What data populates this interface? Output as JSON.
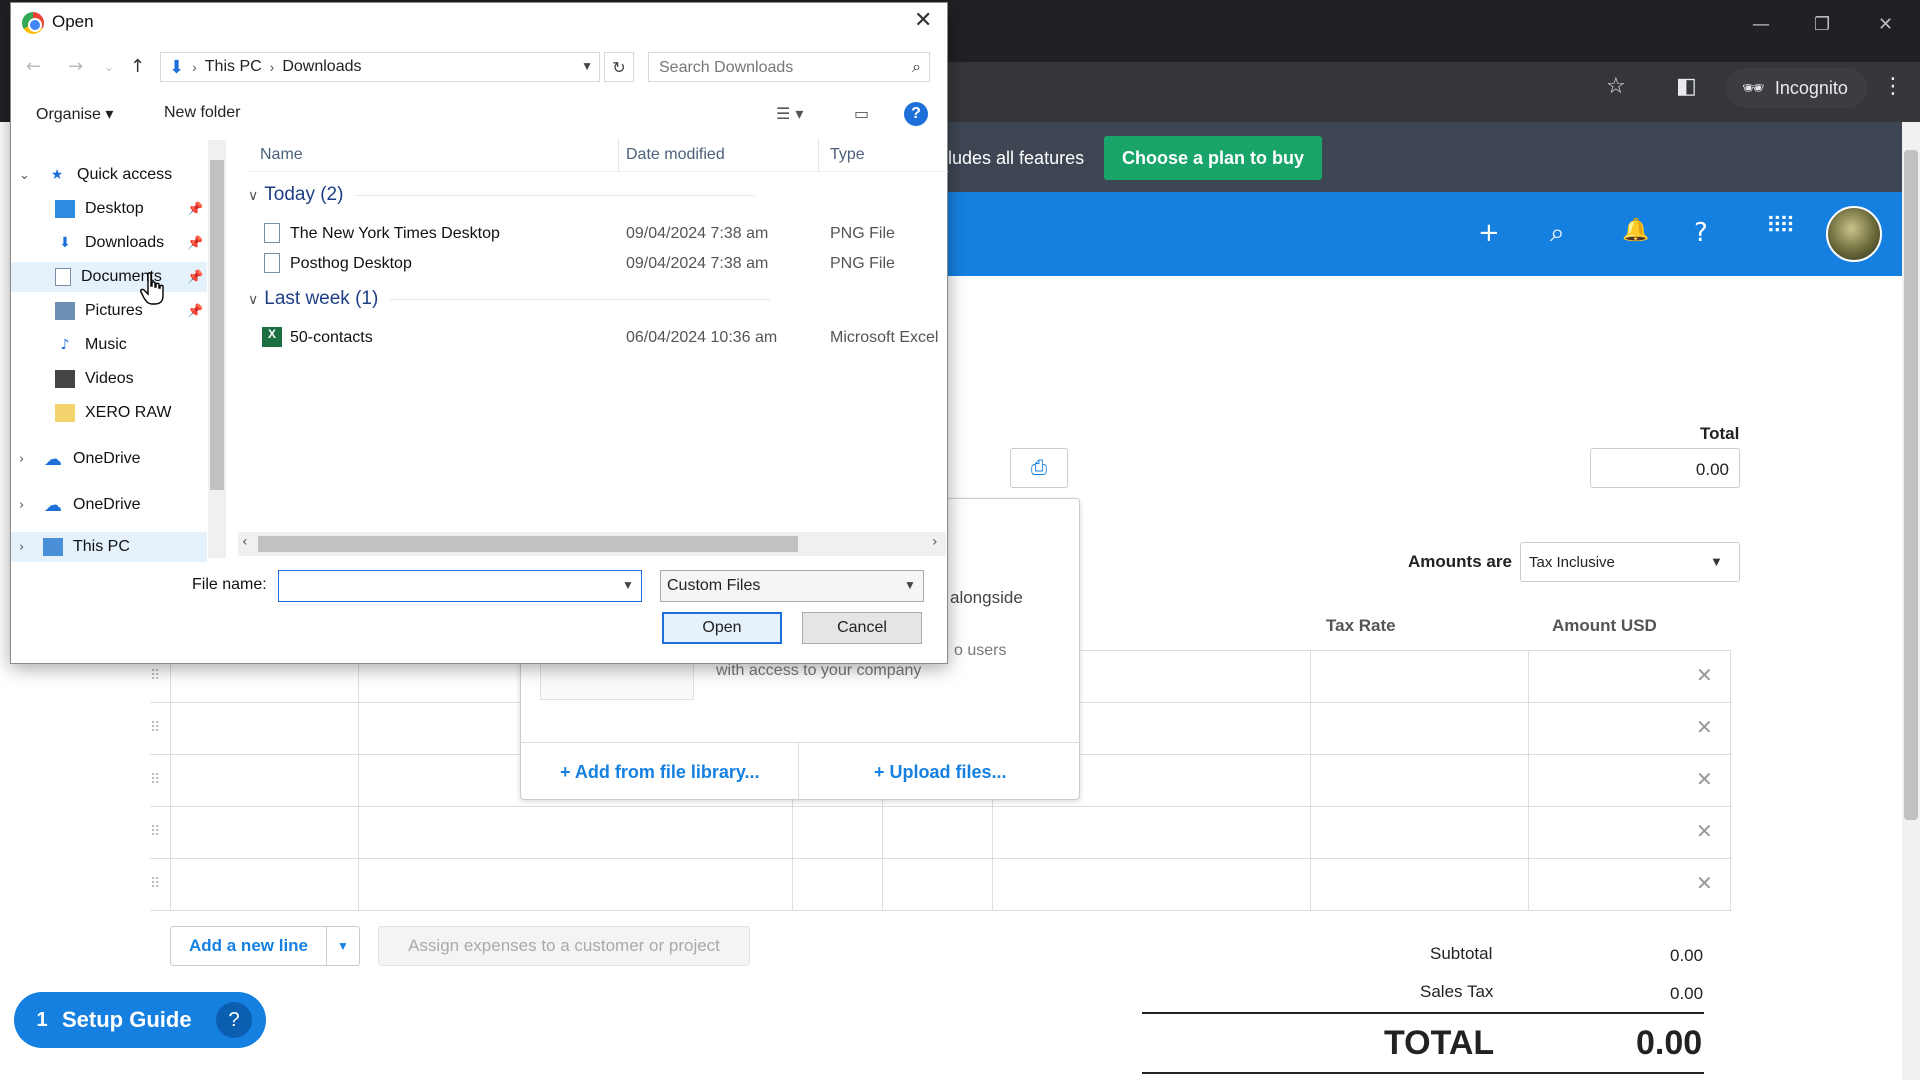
{
  "chrome": {
    "profile": "Incognito",
    "window_controls": {
      "minimize": "—",
      "restore": "❐",
      "close": "✕"
    }
  },
  "banner": {
    "text": "ludes all features",
    "cta": "Choose a plan to buy",
    "colors": {
      "banner_bg": "#3e4654",
      "cta_bg": "#19a56a"
    }
  },
  "xero_header": {
    "icons": [
      "plus-icon",
      "search-icon",
      "bell-icon",
      "help-icon",
      "apps-grid-icon"
    ],
    "bg_color": "#1580e0"
  },
  "bill": {
    "total_label": "Total",
    "total_value": "0.00",
    "amounts_are_label": "Amounts are",
    "amounts_are_value": "Tax Inclusive",
    "columns": {
      "tax_rate": "Tax Rate",
      "amount": "Amount USD"
    },
    "add_line": "Add a new line",
    "assign": "Assign expenses to a customer or project",
    "subtotal_label": "Subtotal",
    "subtotal_value": "0.00",
    "sales_tax_label": "Sales Tax",
    "sales_tax_value": "0.00",
    "grand_total_label": "TOTAL",
    "grand_total_value": "0.00"
  },
  "popover": {
    "text_line1": "alongside",
    "text_line2": "o users",
    "text_line3": "with access to your company",
    "add_from_library": "+ Add from file library...",
    "upload_files": "+ Upload files..."
  },
  "setup_guide": {
    "count": "1",
    "label": "Setup Guide"
  },
  "dialog": {
    "title": "Open",
    "breadcrumb": [
      "This PC",
      "Downloads"
    ],
    "search_placeholder": "Search Downloads",
    "organise": "Organise",
    "new_folder": "New folder",
    "nav": [
      {
        "label": "Quick access",
        "icon": "star-icon",
        "pinned": false
      },
      {
        "label": "Desktop",
        "icon": "desktop-icon",
        "pinned": true
      },
      {
        "label": "Downloads",
        "icon": "download-icon",
        "pinned": true
      },
      {
        "label": "Documents",
        "icon": "document-icon",
        "pinned": true
      },
      {
        "label": "Pictures",
        "icon": "picture-icon",
        "pinned": true
      },
      {
        "label": "Music",
        "icon": "music-icon",
        "pinned": false
      },
      {
        "label": "Videos",
        "icon": "video-icon",
        "pinned": false
      },
      {
        "label": "XERO RAW",
        "icon": "folder-icon",
        "pinned": false
      },
      {
        "label": "OneDrive",
        "icon": "cloud-icon",
        "pinned": false
      },
      {
        "label": "OneDrive",
        "icon": "cloud-icon",
        "pinned": false
      },
      {
        "label": "This PC",
        "icon": "computer-icon",
        "pinned": false
      }
    ],
    "columns": {
      "name": "Name",
      "date": "Date modified",
      "type": "Type"
    },
    "groups": [
      {
        "label": "Today (2)",
        "files": [
          {
            "name": "The New York Times Desktop",
            "date": "09/04/2024 7:38 am",
            "type": "PNG File"
          },
          {
            "name": "Posthog Desktop",
            "date": "09/04/2024 7:38 am",
            "type": "PNG File"
          }
        ]
      },
      {
        "label": "Last week (1)",
        "files": [
          {
            "name": "50-contacts",
            "date": "06/04/2024 10:36 am",
            "type": "Microsoft Excel"
          }
        ]
      }
    ],
    "file_name_label": "File name:",
    "file_name_value": "",
    "file_type_filter": "Custom Files",
    "open_button": "Open",
    "cancel_button": "Cancel"
  }
}
